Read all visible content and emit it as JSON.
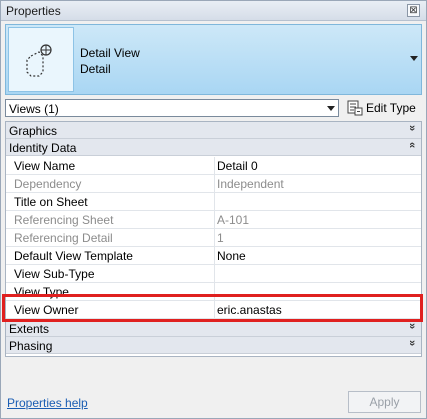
{
  "window": {
    "title": "Properties",
    "close_glyph": "⊠"
  },
  "type_selector": {
    "line1": "Detail View",
    "line2": "Detail",
    "icon": "detail-view-icon"
  },
  "views_filter": {
    "selected": "Views (1)",
    "edit_type_label": "Edit Type"
  },
  "groups": {
    "graphics": "Graphics",
    "identity": "Identity Data",
    "extents": "Extents",
    "phasing": "Phasing"
  },
  "chevrons": {
    "collapsed": "»",
    "expanded": "«"
  },
  "properties": [
    {
      "key": "View Name",
      "value": "Detail 0",
      "enabled": true
    },
    {
      "key": "Dependency",
      "value": "Independent",
      "enabled": false
    },
    {
      "key": "Title on Sheet",
      "value": "",
      "enabled": true
    },
    {
      "key": "Referencing Sheet",
      "value": "A-101",
      "enabled": false
    },
    {
      "key": "Referencing Detail",
      "value": "1",
      "enabled": false
    },
    {
      "key": "Default View Template",
      "value": "None",
      "enabled": true
    },
    {
      "key": "View Sub-Type",
      "value": "",
      "enabled": true
    },
    {
      "key": "View Type",
      "value": "",
      "enabled": true
    },
    {
      "key": "View Owner",
      "value": "eric.anastas",
      "enabled": true
    }
  ],
  "footer": {
    "help_link": "Properties help",
    "apply_label": "Apply"
  },
  "colors": {
    "highlight": "#e0201f",
    "type_bg": "#a9d6f3",
    "link": "#1a5db3"
  }
}
